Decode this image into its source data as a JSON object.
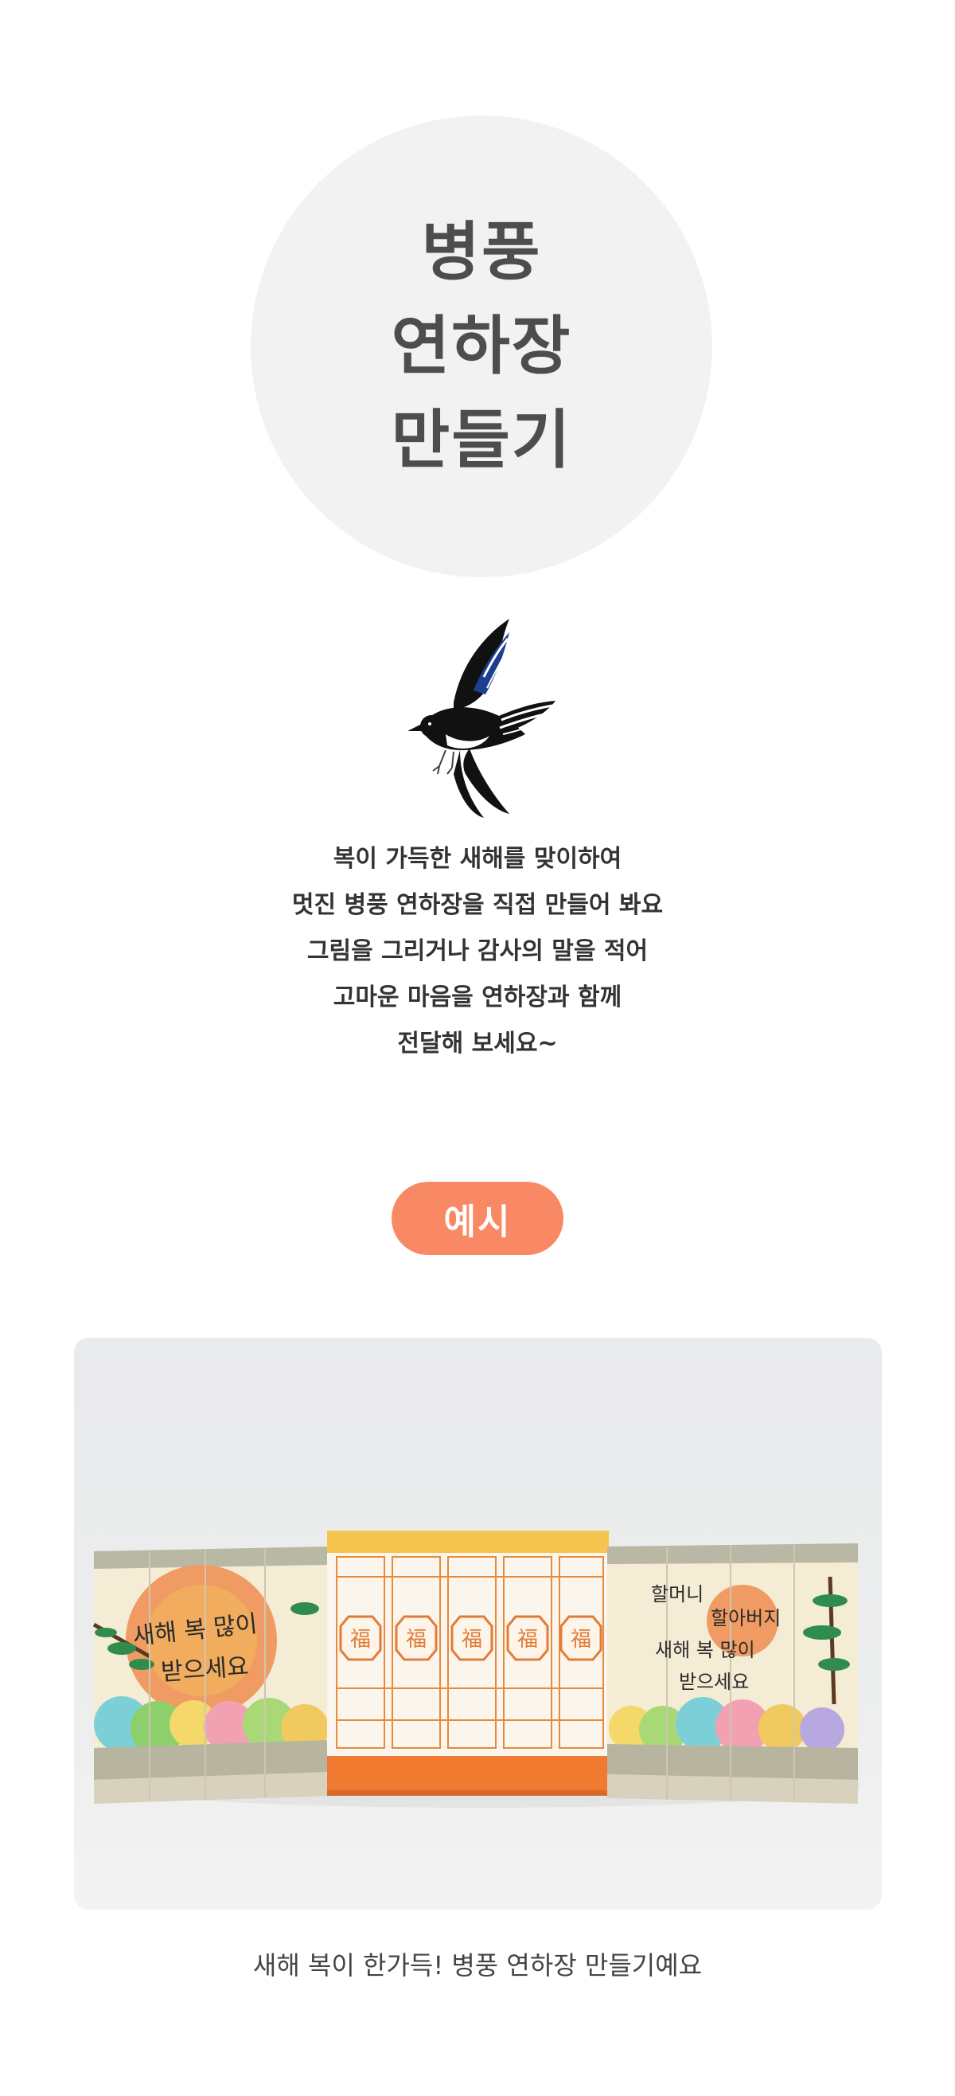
{
  "title": {
    "lines": [
      "병풍",
      "연하장",
      "만들기"
    ]
  },
  "intro": {
    "lines": [
      "복이 가득한 새해를 맞이하여",
      "멋진 병풍 연하장을 직접 만들어 봐요",
      "그림을 그리거나 감사의 말을 적어",
      "고마운 마음을 연하장과 함께",
      "전달해 보세요~"
    ]
  },
  "example": {
    "badge_label": "예시",
    "badge_color": "#f98864",
    "photo": {
      "left_panel_text": [
        "새해 복 많이",
        "받으세요"
      ],
      "center_panel_char": "福",
      "right_panel_text": [
        "할머니",
        "할아버지",
        "새해 복 많이",
        "받으세요"
      ]
    },
    "caption": "새해 복이 한가득! 병풍 연하장 만들기예요"
  },
  "icons": {
    "bird": "magpie-icon"
  }
}
